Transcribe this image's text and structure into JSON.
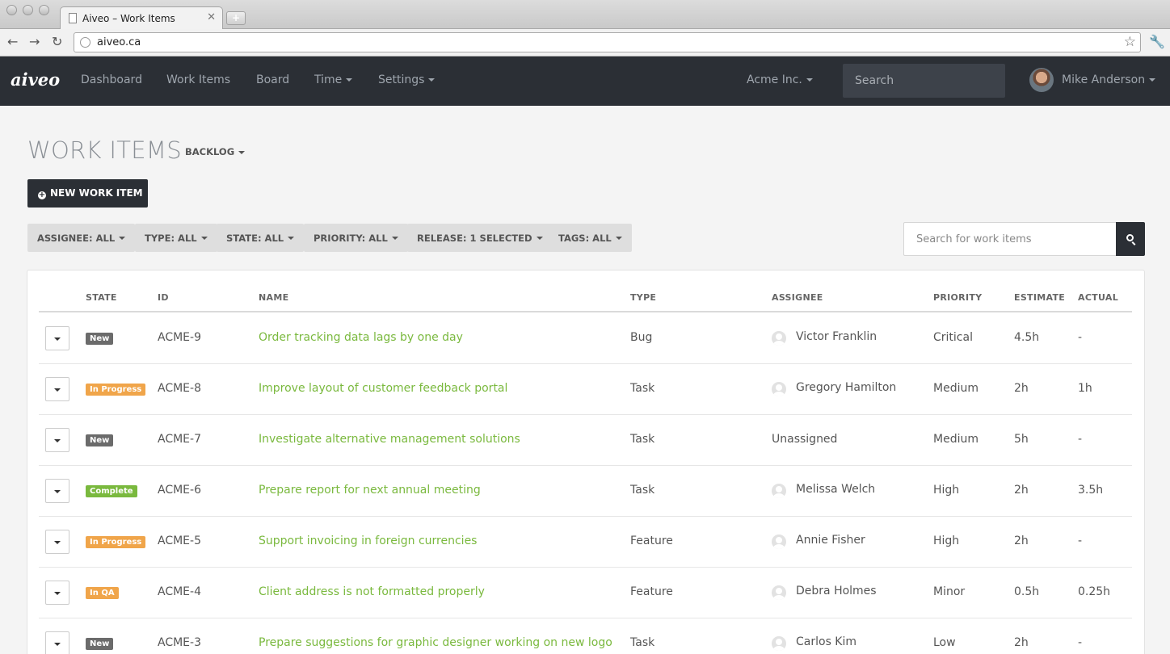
{
  "browser": {
    "tab_title": "Aiveo – Work Items",
    "url": "aiveo.ca"
  },
  "navbar": {
    "logo": "aiveo",
    "items": [
      "Dashboard",
      "Work Items",
      "Board",
      "Time",
      "Settings"
    ],
    "org": "Acme Inc.",
    "search_placeholder": "Search",
    "user": "Mike Anderson"
  },
  "page": {
    "title": "WORK ITEMS",
    "view": "BACKLOG",
    "new_button": "NEW WORK ITEM",
    "filters": [
      "ASSIGNEE: ALL",
      "TYPE: ALL",
      "STATE: ALL",
      "PRIORITY: ALL",
      "RELEASE: 1 SELECTED",
      "TAGS: ALL"
    ],
    "search_placeholder": "Search for work items"
  },
  "table": {
    "headers": [
      "STATE",
      "ID",
      "NAME",
      "TYPE",
      "ASSIGNEE",
      "PRIORITY",
      "ESTIMATE",
      "ACTUAL"
    ],
    "rows": [
      {
        "state": "New",
        "id": "ACME-9",
        "name": "Order tracking data lags by one day",
        "type": "Bug",
        "assignee": "Victor Franklin",
        "priority": "Critical",
        "estimate": "4.5h",
        "actual": "-"
      },
      {
        "state": "In Progress",
        "id": "ACME-8",
        "name": "Improve layout of customer feedback portal",
        "type": "Task",
        "assignee": "Gregory Hamilton",
        "priority": "Medium",
        "estimate": "2h",
        "actual": "1h"
      },
      {
        "state": "New",
        "id": "ACME-7",
        "name": "Investigate alternative management solutions",
        "type": "Task",
        "assignee": "Unassigned",
        "priority": "Medium",
        "estimate": "5h",
        "actual": "-"
      },
      {
        "state": "Complete",
        "id": "ACME-6",
        "name": "Prepare report for next annual meeting",
        "type": "Task",
        "assignee": "Melissa Welch",
        "priority": "High",
        "estimate": "2h",
        "actual": "3.5h"
      },
      {
        "state": "In Progress",
        "id": "ACME-5",
        "name": "Support invoicing in foreign currencies",
        "type": "Feature",
        "assignee": "Annie Fisher",
        "priority": "High",
        "estimate": "2h",
        "actual": "-"
      },
      {
        "state": "In QA",
        "id": "ACME-4",
        "name": "Client address is not formatted properly",
        "type": "Feature",
        "assignee": "Debra Holmes",
        "priority": "Minor",
        "estimate": "0.5h",
        "actual": "0.25h"
      },
      {
        "state": "New",
        "id": "ACME-3",
        "name": "Prepare suggestions for graphic designer working on new logo",
        "type": "Task",
        "assignee": "Carlos Kim",
        "priority": "Low",
        "estimate": "2h",
        "actual": "-"
      }
    ]
  },
  "colors": {
    "navbar": "#2b2f35",
    "link_green": "#7ab93e",
    "state_new": "#6b6b6b",
    "state_in_progress": "#f0a54a",
    "state_complete": "#7ab93e",
    "state_in_qa": "#f0a54a"
  }
}
